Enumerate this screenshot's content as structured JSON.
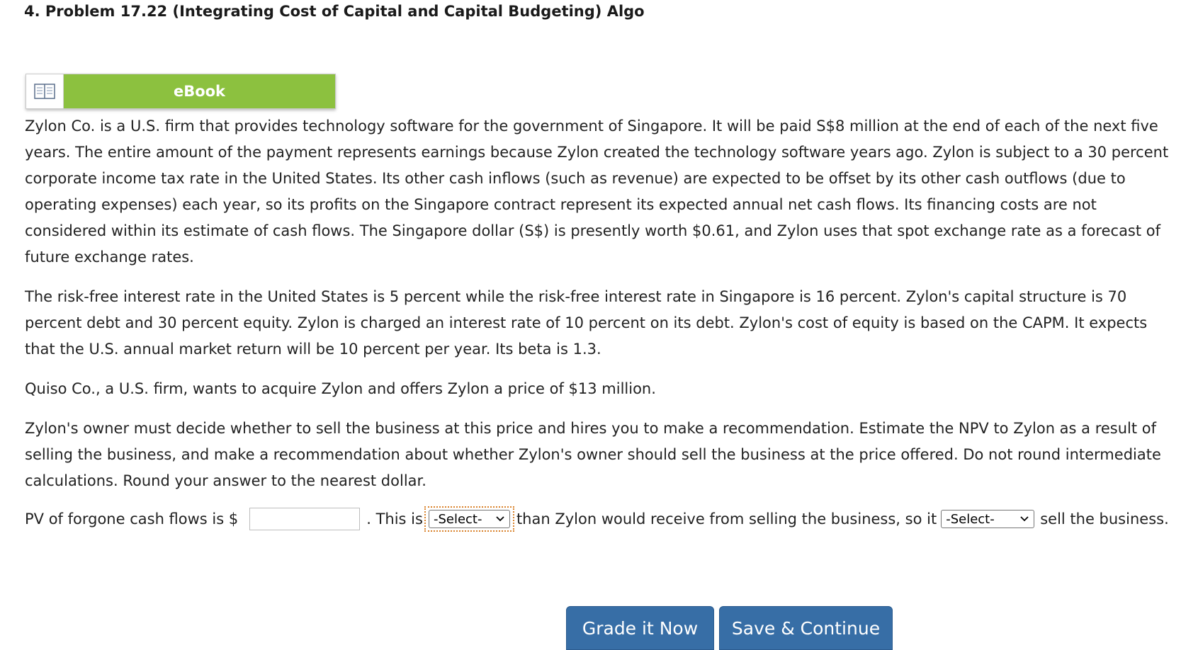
{
  "problem": {
    "title": "4. Problem 17.22 (Integrating Cost of Capital and Capital Budgeting) Algo"
  },
  "ebook": {
    "label": "eBook",
    "icon": "book-icon"
  },
  "paragraphs": [
    "Zylon Co. is a U.S. firm that provides technology software for the government of Singapore. It will be paid S$8 million at the end of each of the next five years. The entire amount of the payment represents earnings because Zylon created the technology software years ago. Zylon is subject to a 30 percent corporate income tax rate in the United States. Its other cash inflows (such as revenue) are expected to be offset by its other cash outflows (due to operating expenses) each year, so its profits on the Singapore contract represent its expected annual net cash flows. Its financing costs are not considered within its estimate of cash flows. The Singapore dollar (S$) is presently worth $0.61, and Zylon uses that spot exchange rate as a forecast of future exchange rates.",
    "The risk-free interest rate in the United States is 5 percent while the risk-free interest rate in Singapore is 16 percent. Zylon's capital structure is 70 percent debt and 30 percent equity. Zylon is charged an interest rate of 10 percent on its debt. Zylon's cost of equity is based on the CAPM. It expects that the U.S. annual market return will be 10 percent per year. Its beta is 1.3.",
    "Quiso Co., a U.S. firm, wants to acquire Zylon and offers Zylon a price of $13 million.",
    "Zylon's owner must decide whether to sell the business at this price and hires you to make a recommendation. Estimate the NPV to Zylon as a result of selling the business, and make a recommendation about whether Zylon's owner should sell the business at the price offered. Do not round intermediate calculations. Round your answer to the nearest dollar."
  ],
  "answer": {
    "prefix": "PV of forgone cash flows is $",
    "input_value": "",
    "mid1": ". This is",
    "select1_value": "-Select-",
    "mid2": "than Zylon would receive from selling the business, so it",
    "select2_value": "-Select-",
    "suffix": "sell the business."
  },
  "buttons": {
    "grade": "Grade it Now",
    "save": "Save & Continue"
  },
  "colors": {
    "ebook_green": "#8cc13f",
    "button_blue": "#376ea6",
    "focus_orange": "#d9822b"
  }
}
